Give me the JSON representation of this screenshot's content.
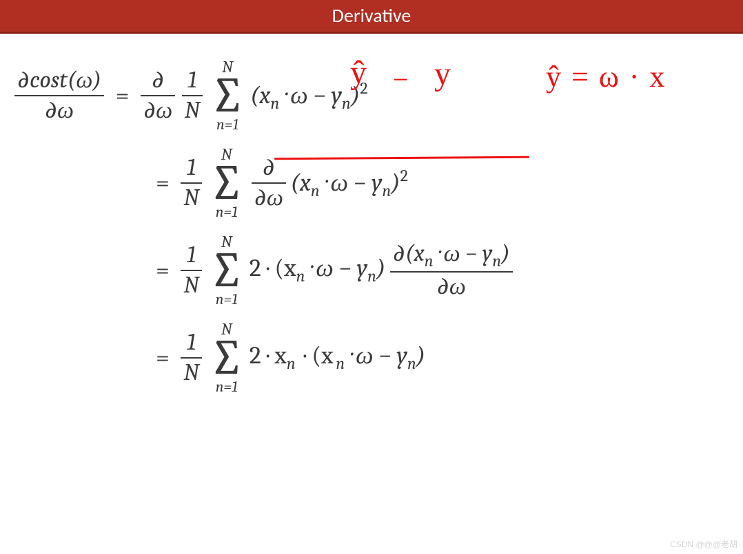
{
  "header": {
    "title": "Derivative"
  },
  "lhs": {
    "num": "∂cost(ω)",
    "den": "∂ω"
  },
  "eq": "=",
  "d_dw": {
    "num": "∂",
    "den": "∂ω"
  },
  "oneN": {
    "num": "1",
    "den": "N"
  },
  "sum": {
    "top": "N",
    "sym": "∑",
    "bot": "n=1"
  },
  "expr1": {
    "a": "(x",
    "b": "n",
    "c": " · ω − y",
    "d": "n",
    "e": ")",
    "f": "2"
  },
  "line3": {
    "pre": "2 · (x",
    "b": "n",
    "c": " · ω − y",
    "d": "n",
    "e": ")"
  },
  "d_inner": {
    "num_a": "∂(x",
    "num_b": "n",
    "num_c": " · ω − y",
    "num_d": "n",
    "num_e": ")",
    "den": "∂ω"
  },
  "line4": {
    "pre": "2 · x",
    "b": "n",
    "c": " · (x",
    "d": "n",
    "e": " · ω − y",
    "f": "n",
    "g": ")"
  },
  "annot": {
    "yhat1": "ŷ",
    "minus": "−",
    "y": "y",
    "eq2": "ŷ = ω · x"
  },
  "watermark": "CSDN @@@老胡"
}
